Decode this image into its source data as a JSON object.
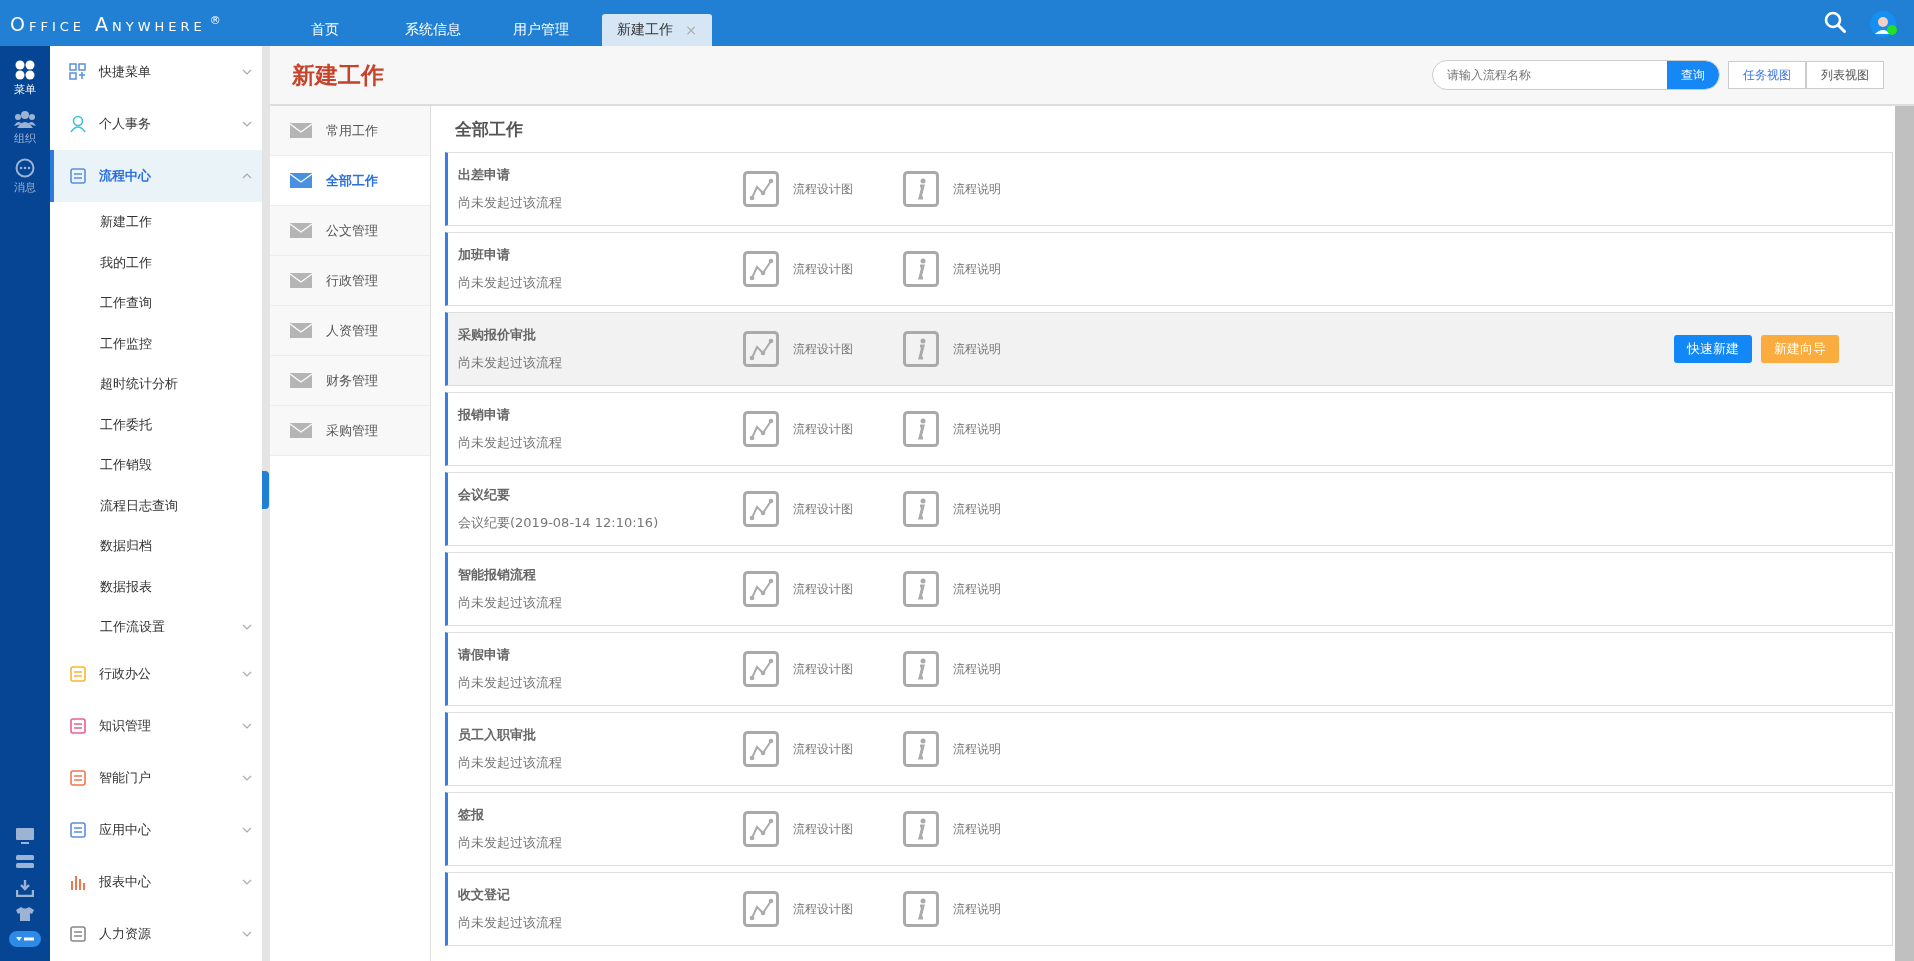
{
  "brand": {
    "name": "Office Anywhere",
    "mark": "®"
  },
  "tabs": [
    {
      "label": "首页",
      "selected": false,
      "closable": false
    },
    {
      "label": "系统信息",
      "selected": false,
      "closable": false
    },
    {
      "label": "用户管理",
      "selected": false,
      "closable": false
    },
    {
      "label": "新建工作",
      "selected": true,
      "closable": true,
      "close": "×"
    }
  ],
  "rail": [
    {
      "label": "菜单",
      "selected": true
    },
    {
      "label": "组织",
      "selected": false
    },
    {
      "label": "消息",
      "selected": false
    }
  ],
  "sidebar": {
    "items": [
      {
        "label": "快捷菜单",
        "selected": false,
        "expanded": false
      },
      {
        "label": "个人事务",
        "selected": false,
        "expanded": false
      },
      {
        "label": "流程中心",
        "selected": true,
        "expanded": true,
        "children": [
          {
            "label": "新建工作"
          },
          {
            "label": "我的工作"
          },
          {
            "label": "工作查询"
          },
          {
            "label": "工作监控"
          },
          {
            "label": "超时统计分析"
          },
          {
            "label": "工作委托"
          },
          {
            "label": "工作销毁"
          },
          {
            "label": "流程日志查询"
          },
          {
            "label": "数据归档"
          },
          {
            "label": "数据报表"
          },
          {
            "label": "工作流设置",
            "expandable": true
          }
        ]
      },
      {
        "label": "行政办公",
        "selected": false,
        "expanded": false
      },
      {
        "label": "知识管理",
        "selected": false,
        "expanded": false
      },
      {
        "label": "智能门户",
        "selected": false,
        "expanded": false
      },
      {
        "label": "应用中心",
        "selected": false,
        "expanded": false
      },
      {
        "label": "报表中心",
        "selected": false,
        "expanded": false
      },
      {
        "label": "人力资源",
        "selected": false,
        "expanded": false
      }
    ]
  },
  "page": {
    "title": "新建工作",
    "search": {
      "placeholder": "请输入流程名称",
      "button": "查询"
    },
    "views": [
      {
        "label": "任务视图",
        "selected": true
      },
      {
        "label": "列表视图",
        "selected": false
      }
    ]
  },
  "categories": [
    {
      "label": "常用工作",
      "selected": false
    },
    {
      "label": "全部工作",
      "selected": true
    },
    {
      "label": "公文管理",
      "selected": false
    },
    {
      "label": "行政管理",
      "selected": false
    },
    {
      "label": "人资管理",
      "selected": false
    },
    {
      "label": "财务管理",
      "selected": false
    },
    {
      "label": "采购管理",
      "selected": false
    }
  ],
  "list": {
    "title": "全部工作",
    "flows": [
      {
        "name": "出差申请",
        "status": "尚未发起过该流程",
        "design": "流程设计图",
        "info": "流程说明",
        "highlighted": false
      },
      {
        "name": "加班申请",
        "status": "尚未发起过该流程",
        "design": "流程设计图",
        "info": "流程说明",
        "highlighted": false
      },
      {
        "name": "采购报价审批",
        "status": "尚未发起过该流程",
        "design": "流程设计图",
        "info": "流程说明",
        "highlighted": true,
        "actions": [
          {
            "label": "快速新建",
            "kind": "primary"
          },
          {
            "label": "新建向导",
            "kind": "warning"
          }
        ]
      },
      {
        "name": "报销申请",
        "status": "尚未发起过该流程",
        "design": "流程设计图",
        "info": "流程说明",
        "highlighted": false
      },
      {
        "name": "会议纪要",
        "status": "会议纪要(2019-08-14 12:10:16)",
        "design": "流程设计图",
        "info": "流程说明",
        "highlighted": false
      },
      {
        "name": "智能报销流程",
        "status": "尚未发起过该流程",
        "design": "流程设计图",
        "info": "流程说明",
        "highlighted": false
      },
      {
        "name": "请假申请",
        "status": "尚未发起过该流程",
        "design": "流程设计图",
        "info": "流程说明",
        "highlighted": false
      },
      {
        "name": "员工入职审批",
        "status": "尚未发起过该流程",
        "design": "流程设计图",
        "info": "流程说明",
        "highlighted": false
      },
      {
        "name": "签报",
        "status": "尚未发起过该流程",
        "design": "流程设计图",
        "info": "流程说明",
        "highlighted": false
      },
      {
        "name": "收文登记",
        "status": "尚未发起过该流程",
        "design": "流程设计图",
        "info": "流程说明",
        "highlighted": false
      }
    ]
  }
}
